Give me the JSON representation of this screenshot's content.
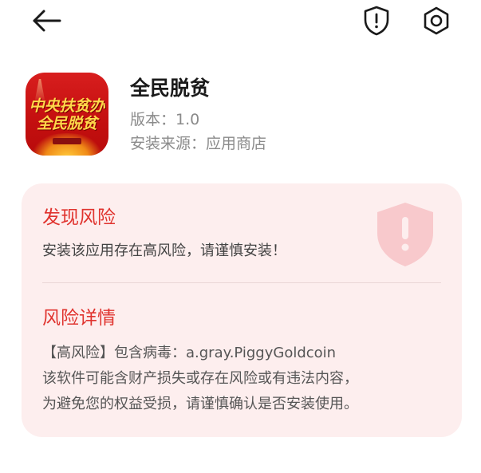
{
  "topbar": {
    "back_icon": "arrow-left-icon",
    "shield_icon": "shield-alert-icon",
    "settings_icon": "settings-hexagon-icon"
  },
  "app": {
    "icon_text_line1": "中央扶贫办",
    "icon_text_line2": "全民脱贫",
    "name": "全民脱贫",
    "version_text": "版本：1.0",
    "source_text": "安装来源：应用商店"
  },
  "risk": {
    "found_title": "发现风险",
    "warning_text": "安装该应用存在高风险，请谨慎安装！",
    "detail_title": "风险详情",
    "detail_lines": [
      "【高风险】包含病毒：a.gray.PiggyGoldcoin",
      "该软件可能含财产损失或存在风险或有违法内容，",
      "为避免您的权益受损，请谨慎确认是否安装使用。"
    ]
  },
  "colors": {
    "accent_red": "#e0332e",
    "card_background": "#fdeeee",
    "shield_tint": "#f8c9cc"
  }
}
